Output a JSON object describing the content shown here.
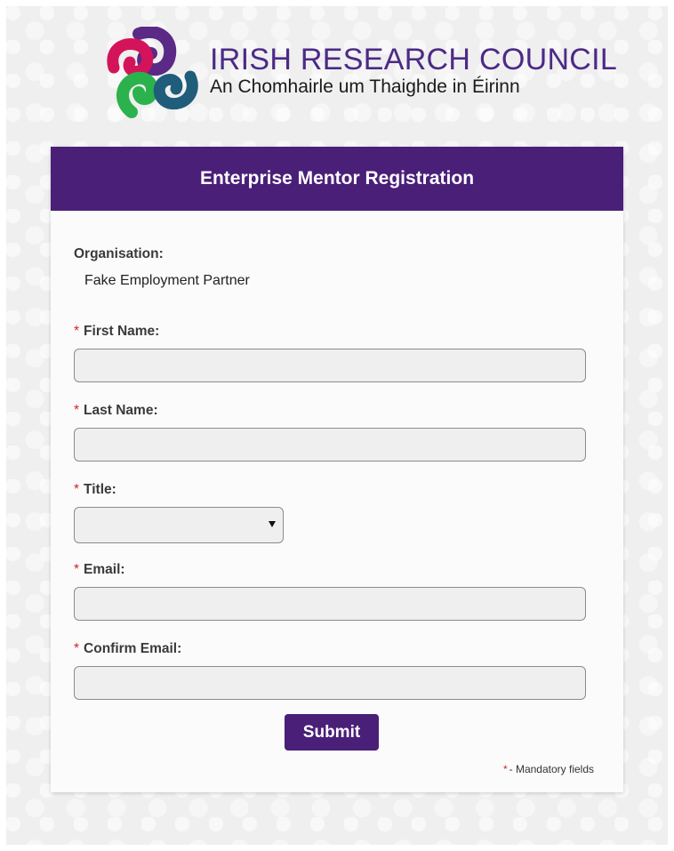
{
  "logo": {
    "title": "IRISH RESEARCH COUNCIL",
    "subtitle": "An Chomhairle um Thaighde in Éirinn",
    "colors": {
      "purple": "#5b2a86",
      "magenta": "#d4145a",
      "green": "#2bb24c"
    }
  },
  "form": {
    "heading": "Enterprise Mentor Registration",
    "organisation_label": "Organisation:",
    "organisation_value": "Fake Employment Partner",
    "required_marker": "*",
    "fields": {
      "first_name": {
        "label": "First Name:",
        "value": ""
      },
      "last_name": {
        "label": "Last Name:",
        "value": ""
      },
      "title": {
        "label": "Title:",
        "selected": ""
      },
      "email": {
        "label": "Email:",
        "value": ""
      },
      "confirm_email": {
        "label": "Confirm Email:",
        "value": ""
      }
    },
    "submit_label": "Submit",
    "mandatory_note": "- Mandatory fields"
  },
  "colors": {
    "header_bg": "#4a1f78",
    "required": "#d2232a"
  }
}
